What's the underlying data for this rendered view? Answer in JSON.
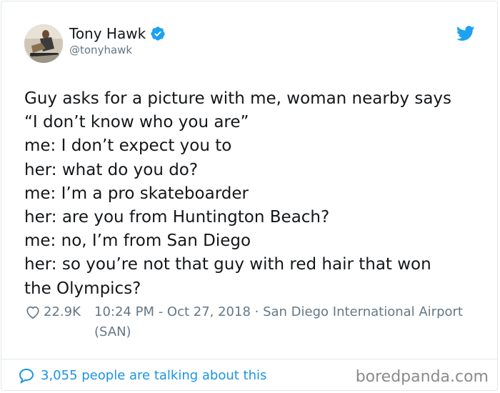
{
  "user": {
    "display_name": "Tony Hawk",
    "handle": "@tonyhawk",
    "verified_icon": "verified-badge-icon",
    "avatar_icon": "avatar"
  },
  "brand": {
    "logo_icon": "twitter-bird-icon",
    "accent_color": "#1DA1F2"
  },
  "tweet": {
    "lines": [
      "Guy asks for a picture with me, woman nearby says",
      "“I don’t know who you are”",
      "me: I don’t expect you to",
      "her: what do you do?",
      "me: I’m a pro skateboarder",
      "her: are you from Huntington Beach?",
      "me: no, I’m from San Diego",
      "her: so you’re not that guy with red hair that won",
      "the Olympics?"
    ]
  },
  "meta": {
    "likes": "22.9K",
    "heart_icon": "heart-icon",
    "timestamp": "10:24 PM - Oct 27, 2018 · San Diego International Airport (SAN)"
  },
  "footer": {
    "talking_icon": "speech-bubble-icon",
    "talking_text": "3,055 people are talking about this",
    "watermark": "boredpanda.com"
  }
}
